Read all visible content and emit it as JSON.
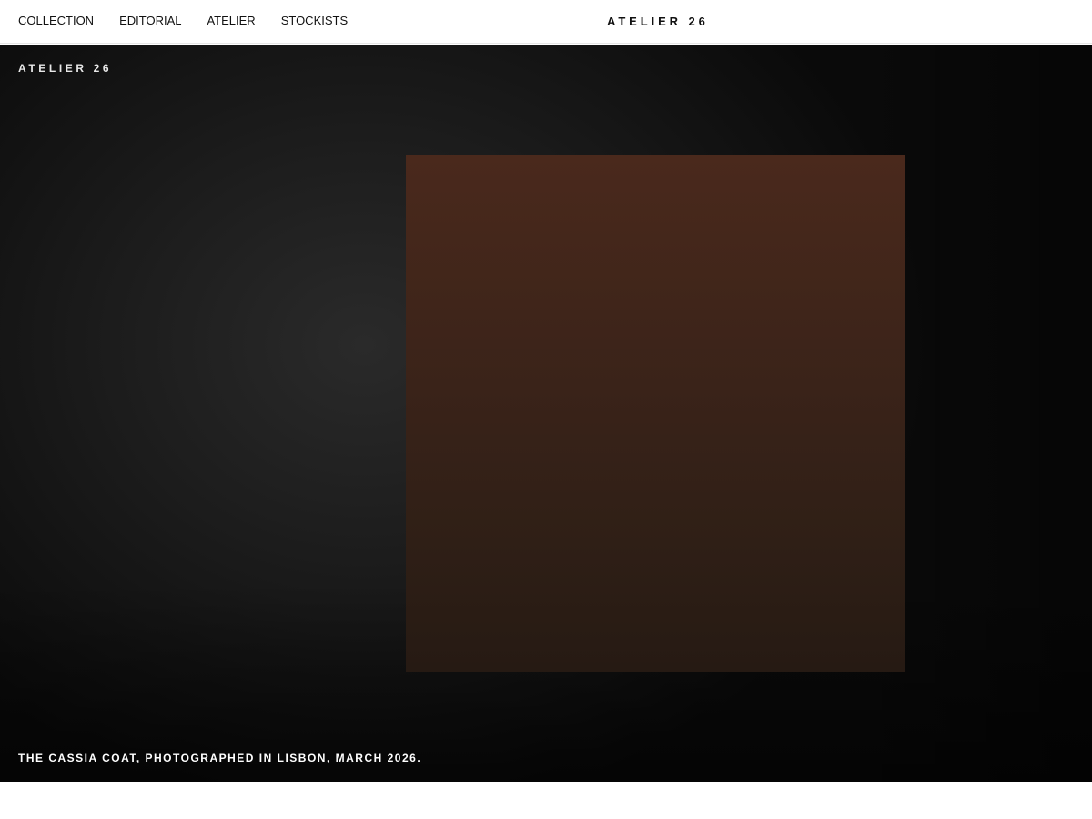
{
  "header": {
    "nav": [
      {
        "label": "COLLECTION"
      },
      {
        "label": "EDITORIAL"
      },
      {
        "label": "ATELIER"
      },
      {
        "label": "STOCKISTS"
      }
    ],
    "brand": "ATELIER 26"
  },
  "hero": {
    "label": "ATELIER 26",
    "caption": "THE CASSIA COAT, PHOTOGRAPHED IN LISBON, MARCH 2026."
  }
}
